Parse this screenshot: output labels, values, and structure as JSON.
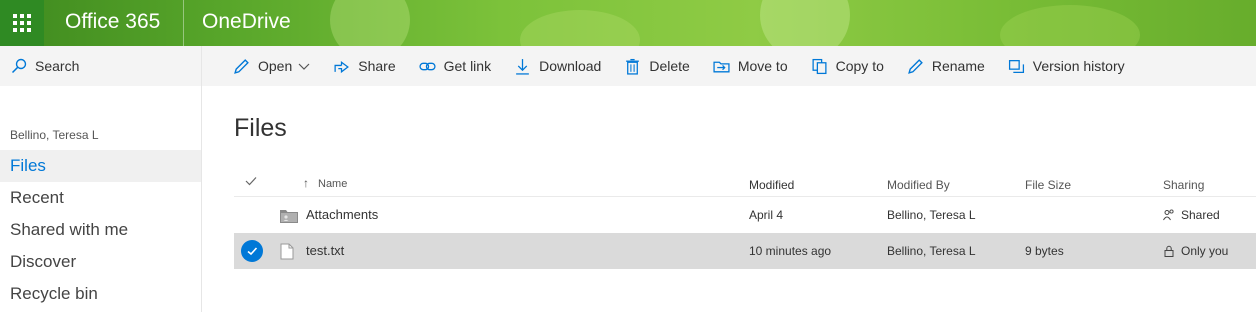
{
  "suite": {
    "brand": "Office 365",
    "app": "OneDrive"
  },
  "nav": {
    "search_label": "Search",
    "user": "Bellino, Teresa L",
    "items": [
      {
        "label": "Files",
        "active": true
      },
      {
        "label": "Recent"
      },
      {
        "label": "Shared with me"
      },
      {
        "label": "Discover"
      },
      {
        "label": "Recycle bin"
      }
    ]
  },
  "commands": {
    "open": "Open",
    "share": "Share",
    "get_link": "Get link",
    "download": "Download",
    "delete": "Delete",
    "move_to": "Move to",
    "copy_to": "Copy to",
    "rename": "Rename",
    "version_history": "Version history"
  },
  "page_title": "Files",
  "columns": {
    "name": "Name",
    "modified": "Modified",
    "modified_by": "Modified By",
    "file_size": "File Size",
    "sharing": "Sharing"
  },
  "rows": [
    {
      "name": "Attachments",
      "type": "folder-icon",
      "modified": "April 4",
      "modified_by": "Bellino, Teresa L",
      "file_size": "",
      "sharing": "Shared",
      "sharing_icon": "people-icon",
      "selected": false
    },
    {
      "name": "test.txt",
      "type": "text-file-icon",
      "modified": "10 minutes ago",
      "modified_by": "Bellino, Teresa L",
      "file_size": "9 bytes",
      "sharing": "Only you",
      "sharing_icon": "lock-icon",
      "selected": true
    }
  ],
  "colors": {
    "accent": "#0078d7",
    "suite_green": "#58a62a",
    "waffle_bg": "#2f8a23"
  }
}
